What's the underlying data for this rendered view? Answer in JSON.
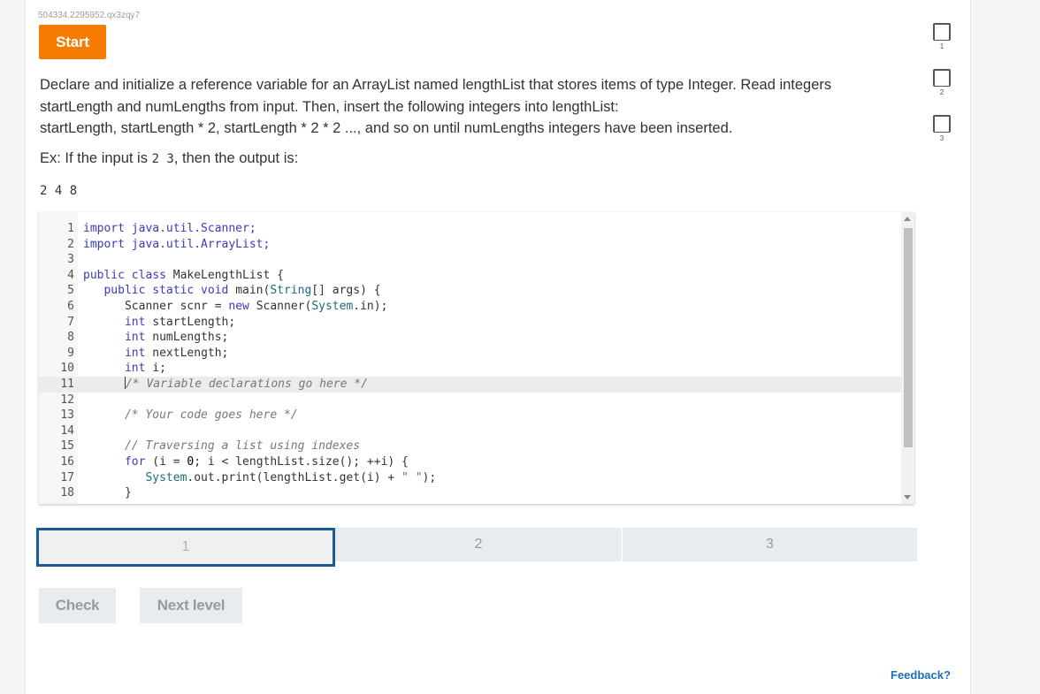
{
  "activity_id": "504334.2295952.qx3zqy7",
  "start_label": "Start",
  "prompt": {
    "line1": "Declare and initialize a reference variable for an ArrayList named lengthList that stores items of type Integer. Read integers",
    "line2": "startLength and numLengths from input. Then, insert the following integers into lengthList:",
    "line3": "startLength, startLength * 2, startLength * 2 * 2 ..., and so on until numLengths integers have been inserted."
  },
  "example": {
    "prefix": "Ex: If the input is ",
    "input": "2 3",
    "suffix": ", then the output is:",
    "output": "2 4 8"
  },
  "code": {
    "line_numbers": [
      "1",
      "2",
      "3",
      "4",
      "5",
      "6",
      "7",
      "8",
      "9",
      "10",
      "11",
      "12",
      "13",
      "14",
      "15",
      "16",
      "17",
      "18"
    ],
    "l1": "import java.util.Scanner;",
    "l2": "import java.util.ArrayList;",
    "l4a": "public class ",
    "l4b": "MakeLengthList {",
    "l5a": "   public static void ",
    "l5b": "main(",
    "l5c": "String",
    "l5d": "[] args) {",
    "l6a": "      Scanner scnr = ",
    "l6b": "new ",
    "l6c": "Scanner(",
    "l6d": "System",
    "l6e": ".in);",
    "l7a": "      int ",
    "l7b": "startLength;",
    "l8a": "      int ",
    "l8b": "numLengths;",
    "l9a": "      int ",
    "l9b": "nextLength;",
    "l10a": "      int ",
    "l10b": "i;",
    "l11": "/* Variable declarations go here */",
    "l13": "      /* Your code goes here */",
    "l15": "      // Traversing a list using indexes",
    "l16a": "      for ",
    "l16b": "(i = ",
    "l16c": "0",
    "l16d": "; i < lengthList.size(); ++i) {",
    "l17a": "         System",
    "l17b": ".out.print(lengthList.get(i) + ",
    "l17c": "\" \"",
    "l17d": ");",
    "l18": "      }"
  },
  "levels": [
    "1",
    "2",
    "3"
  ],
  "check_label": "Check",
  "next_label": "Next level",
  "progress": [
    {
      "number": "1",
      "completed": false
    },
    {
      "number": "2",
      "completed": false
    },
    {
      "number": "3",
      "completed": false
    }
  ],
  "feedback_label": "Feedback?",
  "colors": {
    "start_button": "#f57c00",
    "active_level_border": "#1a5a96",
    "feedback_link": "#1a6fb5"
  }
}
